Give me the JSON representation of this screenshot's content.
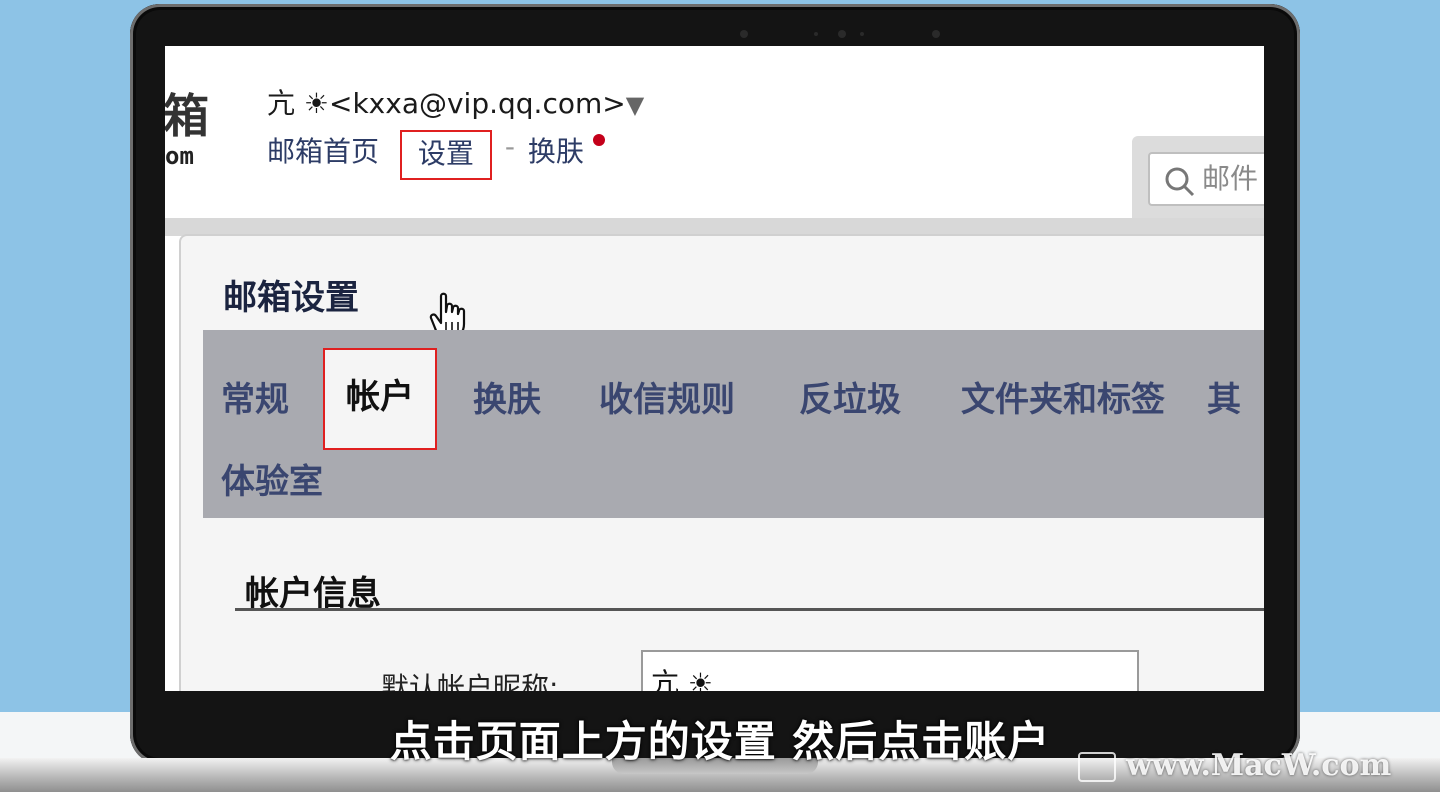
{
  "header": {
    "logo_char": "箱",
    "logo_sub": "om",
    "account": "亢 ☀<kxxa@vip.qq.com>",
    "account_caret": "▼",
    "links": {
      "home": "邮箱首页",
      "settings": "设置",
      "separator": "-",
      "skin": "换肤"
    },
    "search_placeholder": "邮件"
  },
  "settings": {
    "title": "邮箱设置",
    "tabs": [
      "常规",
      "帐户",
      "换肤",
      "收信规则",
      "反垃圾",
      "文件夹和标签",
      "其",
      "体验室"
    ],
    "active_tab": "帐户",
    "section_title": "帐户信息",
    "nickname_label": "默认帐户昵称:",
    "nickname_value": "亢 ☀"
  },
  "subtitle": "点击页面上方的设置 然后点击账户",
  "watermark": "www.MacW.com",
  "colors": {
    "highlight": "#e02020",
    "tab_bar": "#a9aab0",
    "link": "#2d3c66",
    "notify_dot": "#c4001a"
  }
}
